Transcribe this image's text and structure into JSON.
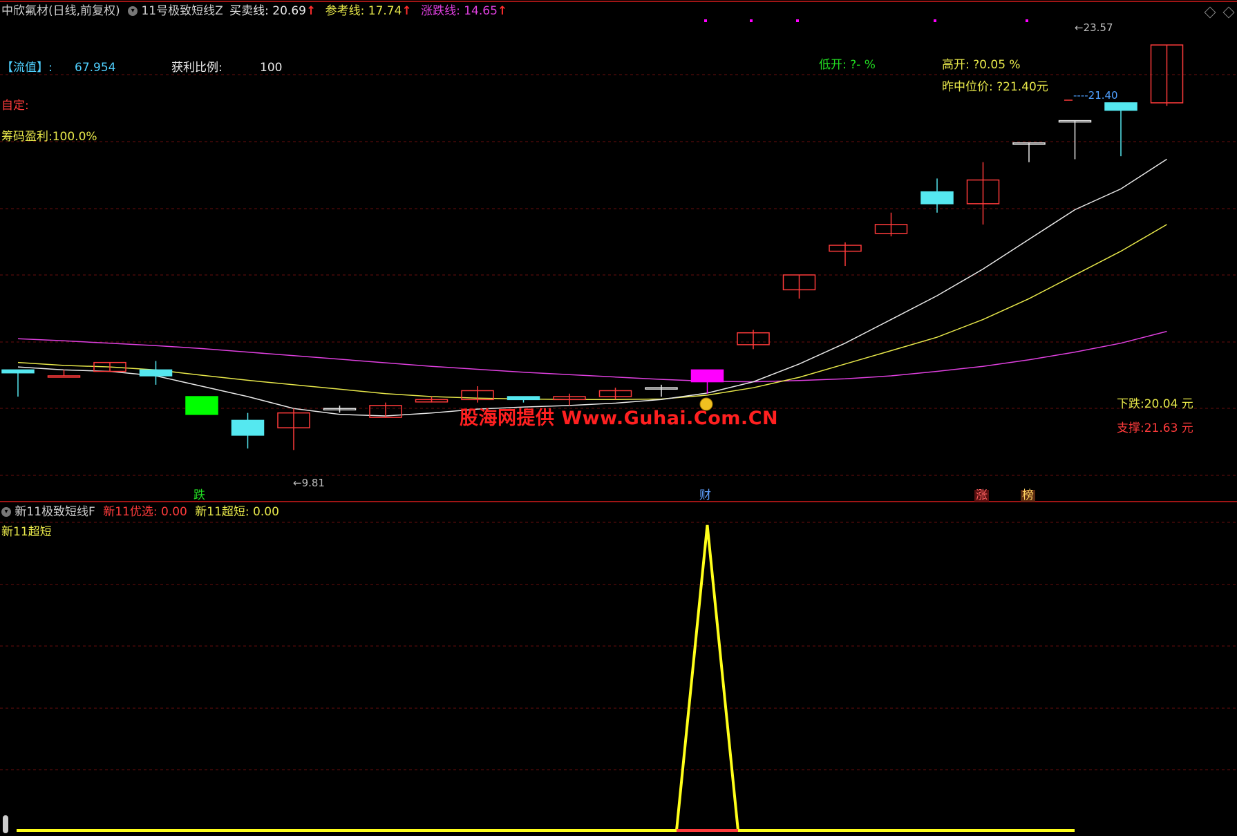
{
  "header": {
    "stock_name": "中欣氟材(日线,前复权)",
    "indicator_name": "11号极致短线Z",
    "buy_sell_label": "买卖线: 20.69",
    "ref_label": "参考线: 17.74",
    "zd_label": "涨跌线: 14.65"
  },
  "info": {
    "liuzhi_label": "【流值】:",
    "liuzhi_value": "67.954",
    "profit_ratio_label": "获利比例:",
    "profit_ratio_value": "100",
    "custom_label": "自定:",
    "chip_label": "筹码盈利:100.0%",
    "low_open": "低开: ?- %",
    "high_open": "高开: ?0.05 %",
    "yesterday_mid": "昨中位价: ?21.40元",
    "fall_label": "下跌:20.04 元",
    "support_label": "支撑:21.63 元",
    "watermark": "股海网提供 Www.Guhai.Com.CN"
  },
  "markers": {
    "die": "跌",
    "cai": "财",
    "zhang": "涨",
    "bang": "榜",
    "low_price": "9.81",
    "high_price": "23.57",
    "level_price": "21.40"
  },
  "sub": {
    "indicator_name": "新11极致短线F",
    "youxuan": "新11优选: 0.00",
    "chaoduan": "新11超短: 0.00",
    "chaoduan_label": "新11超短"
  },
  "colors": {
    "up": "#ff3b3b",
    "down": "#55e8f0",
    "special_green": "#00ff00",
    "special_magenta": "#ff00ff",
    "white_line": "#e8e8e8",
    "yellow_line": "#e8e84a",
    "magenta_line": "#e040e0",
    "sub_line": "#ffff1a"
  },
  "chart_data": {
    "type": "candlestick",
    "price_range": [
      8.8,
      24.4
    ],
    "candles": [
      {
        "o": 12.4,
        "c": 12.3,
        "h": 12.4,
        "l": 11.5,
        "k": "down"
      },
      {
        "o": 12.2,
        "c": 12.2,
        "h": 12.4,
        "l": 12.2,
        "k": "up"
      },
      {
        "o": 12.35,
        "c": 12.65,
        "h": 12.65,
        "l": 12.35,
        "k": "up"
      },
      {
        "o": 12.4,
        "c": 12.2,
        "h": 12.7,
        "l": 11.9,
        "k": "down"
      },
      {
        "o": 11.5,
        "c": 10.9,
        "h": 11.5,
        "l": 10.9,
        "k": "green"
      },
      {
        "o": 10.7,
        "c": 10.2,
        "h": 10.95,
        "l": 9.75,
        "k": "down"
      },
      {
        "o": 10.45,
        "c": 10.95,
        "h": 11.1,
        "l": 9.7,
        "k": "up"
      },
      {
        "o": 11.1,
        "c": 11.1,
        "h": 11.2,
        "l": 10.96,
        "k": "flat"
      },
      {
        "o": 10.8,
        "c": 11.2,
        "h": 11.3,
        "l": 10.8,
        "k": "up"
      },
      {
        "o": 11.32,
        "c": 11.4,
        "h": 11.5,
        "l": 11.3,
        "k": "up"
      },
      {
        "o": 11.4,
        "c": 11.7,
        "h": 11.85,
        "l": 11.3,
        "k": "up"
      },
      {
        "o": 11.5,
        "c": 11.4,
        "h": 11.5,
        "l": 11.3,
        "k": "down"
      },
      {
        "o": 11.4,
        "c": 11.5,
        "h": 11.6,
        "l": 11.2,
        "k": "up"
      },
      {
        "o": 11.5,
        "c": 11.7,
        "h": 11.8,
        "l": 11.4,
        "k": "up"
      },
      {
        "o": 11.8,
        "c": 11.8,
        "h": 11.9,
        "l": 11.5,
        "k": "flat"
      },
      {
        "o": 12.0,
        "c": 12.4,
        "h": 12.4,
        "l": 11.6,
        "k": "magenta"
      },
      {
        "o": 13.25,
        "c": 13.65,
        "h": 13.75,
        "l": 13.1,
        "k": "up"
      },
      {
        "o": 15.1,
        "c": 15.6,
        "h": 15.6,
        "l": 14.8,
        "k": "up"
      },
      {
        "o": 16.4,
        "c": 16.6,
        "h": 16.7,
        "l": 15.9,
        "k": "up"
      },
      {
        "o": 17.0,
        "c": 17.3,
        "h": 17.7,
        "l": 16.9,
        "k": "up"
      },
      {
        "o": 18.4,
        "c": 18.0,
        "h": 18.85,
        "l": 17.7,
        "k": "down"
      },
      {
        "o": 18.0,
        "c": 18.8,
        "h": 19.4,
        "l": 17.3,
        "k": "up"
      },
      {
        "o": 20.02,
        "c": 20.05,
        "h": 20.05,
        "l": 19.4,
        "k": "flat"
      },
      {
        "o": 20.8,
        "c": 20.8,
        "h": 20.8,
        "l": 19.5,
        "k": "flat"
      },
      {
        "o": 21.15,
        "c": 21.4,
        "h": 21.4,
        "l": 19.6,
        "k": "down"
      },
      {
        "o": 23.35,
        "c": 21.4,
        "h": 23.35,
        "l": 21.3,
        "k": "up"
      }
    ],
    "ma_white": [
      12.5,
      12.4,
      12.35,
      12.2,
      11.85,
      11.5,
      11.1,
      10.9,
      10.85,
      10.95,
      11.08,
      11.15,
      11.2,
      11.28,
      11.4,
      11.62,
      12.0,
      12.6,
      13.3,
      14.1,
      14.9,
      15.8,
      16.8,
      17.8,
      18.5,
      19.5
    ],
    "ma_yellow": [
      12.65,
      12.55,
      12.5,
      12.4,
      12.22,
      12.05,
      11.9,
      11.75,
      11.6,
      11.5,
      11.45,
      11.42,
      11.4,
      11.4,
      11.42,
      11.55,
      11.8,
      12.15,
      12.6,
      13.05,
      13.5,
      14.1,
      14.8,
      15.6,
      16.4,
      17.3
    ],
    "ma_magenta": [
      13.45,
      13.38,
      13.3,
      13.22,
      13.12,
      13.0,
      12.88,
      12.76,
      12.64,
      12.52,
      12.42,
      12.32,
      12.24,
      12.16,
      12.08,
      12.02,
      12.0,
      12.04,
      12.1,
      12.2,
      12.35,
      12.52,
      12.74,
      13.0,
      13.3,
      13.7
    ],
    "sub_values": [
      0,
      0,
      0,
      0,
      0,
      0,
      0,
      0,
      0,
      0,
      0,
      0,
      0,
      0,
      0,
      1,
      0,
      0,
      0,
      0,
      0,
      0,
      0,
      0,
      0,
      0
    ],
    "sub_range": [
      0,
      1
    ]
  }
}
